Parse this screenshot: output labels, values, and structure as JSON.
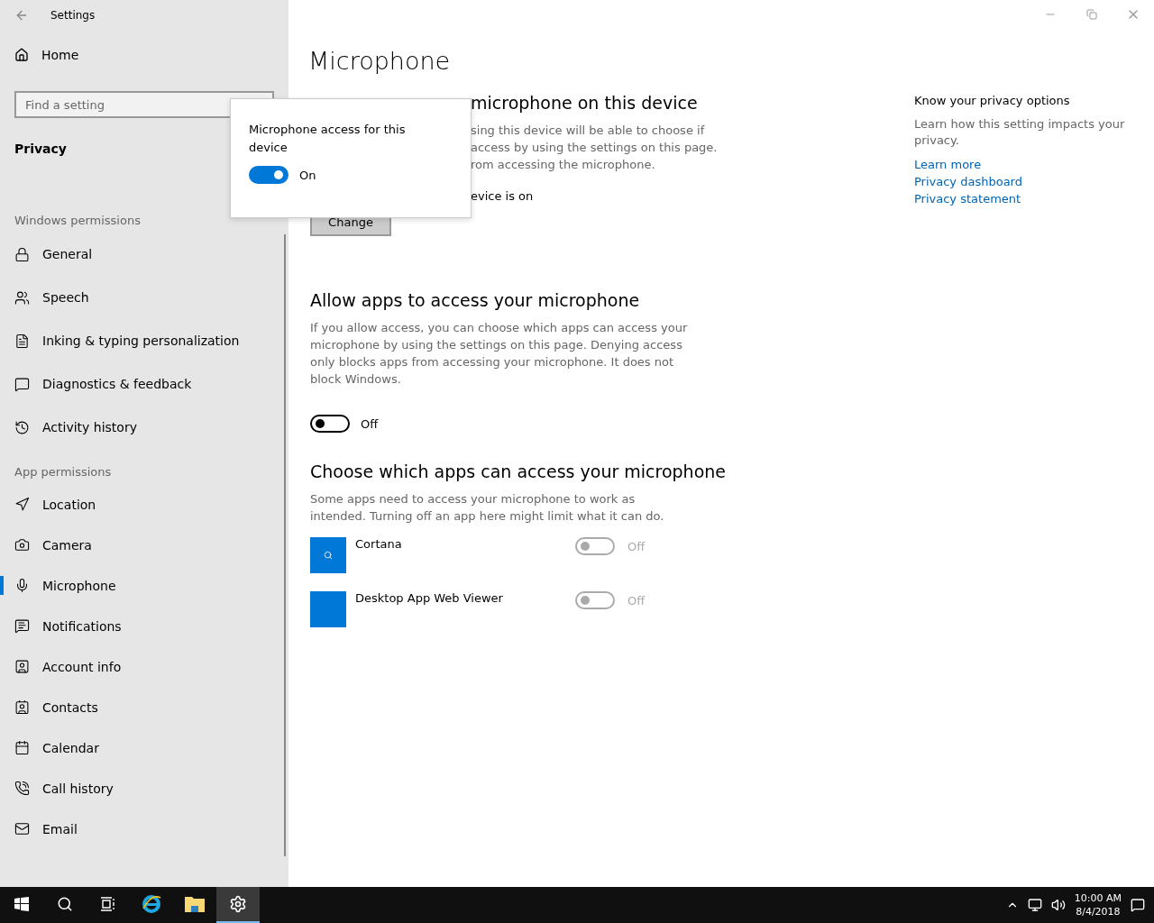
{
  "window": {
    "title": "Settings"
  },
  "sidebar": {
    "home": "Home",
    "search": {
      "placeholder": "Find a setting"
    },
    "section_title": "Privacy",
    "groups": [
      {
        "heading": "Windows permissions",
        "items": [
          {
            "label": "General",
            "selected": false
          },
          {
            "label": "Speech",
            "selected": false
          },
          {
            "label": "Inking & typing personalization",
            "selected": false
          },
          {
            "label": "Diagnostics & feedback",
            "selected": false
          },
          {
            "label": "Activity history",
            "selected": false
          }
        ]
      },
      {
        "heading": "App permissions",
        "items": [
          {
            "label": "Location",
            "selected": false
          },
          {
            "label": "Camera",
            "selected": false
          },
          {
            "label": "Microphone",
            "selected": true
          },
          {
            "label": "Notifications",
            "selected": false
          },
          {
            "label": "Account info",
            "selected": false
          },
          {
            "label": "Contacts",
            "selected": false
          },
          {
            "label": "Calendar",
            "selected": false
          },
          {
            "label": "Call history",
            "selected": false
          },
          {
            "label": "Email",
            "selected": false
          }
        ]
      }
    ]
  },
  "main": {
    "title": "Microphone",
    "device_section": {
      "heading": "microphone on this device",
      "lines": [
        "sing this device will be able to choose if",
        "access by using the settings on this page.",
        "rom accessing the microphone."
      ],
      "status": "evice is on",
      "button": "Change"
    },
    "allow_section": {
      "heading": "Allow apps to access your microphone",
      "body": "If you allow access, you can choose which apps can access your microphone by using the settings on this page. Denying access only blocks apps from accessing your microphone. It does not block Windows.",
      "toggle": {
        "on": false,
        "disabled": false,
        "label": "Off"
      }
    },
    "apps_section": {
      "heading": "Choose which apps can access your microphone",
      "body": "Some apps need to access your microphone to work as intended. Turning off an app here might limit what it can do.",
      "apps": [
        {
          "name": "Cortana",
          "kind": "search",
          "toggle": {
            "on": false,
            "disabled": true,
            "label": "Off"
          }
        },
        {
          "name": "Desktop App Web Viewer",
          "kind": "blank",
          "toggle": {
            "on": false,
            "disabled": true,
            "label": "Off"
          }
        }
      ]
    }
  },
  "popup": {
    "title": "Microphone access for this device",
    "toggle": {
      "on": true,
      "disabled": false,
      "label": "On"
    }
  },
  "aside": {
    "heading": "Know your privacy options",
    "text": "Learn how this setting impacts your privacy.",
    "links": [
      "Learn more",
      "Privacy dashboard",
      "Privacy statement"
    ]
  },
  "taskbar": {
    "apps": [
      {
        "kind": "explorer",
        "selected": false
      },
      {
        "kind": "folder",
        "selected": false
      },
      {
        "kind": "settings",
        "selected": true
      }
    ],
    "time": "10:00 AM",
    "date": "8/4/2018"
  }
}
